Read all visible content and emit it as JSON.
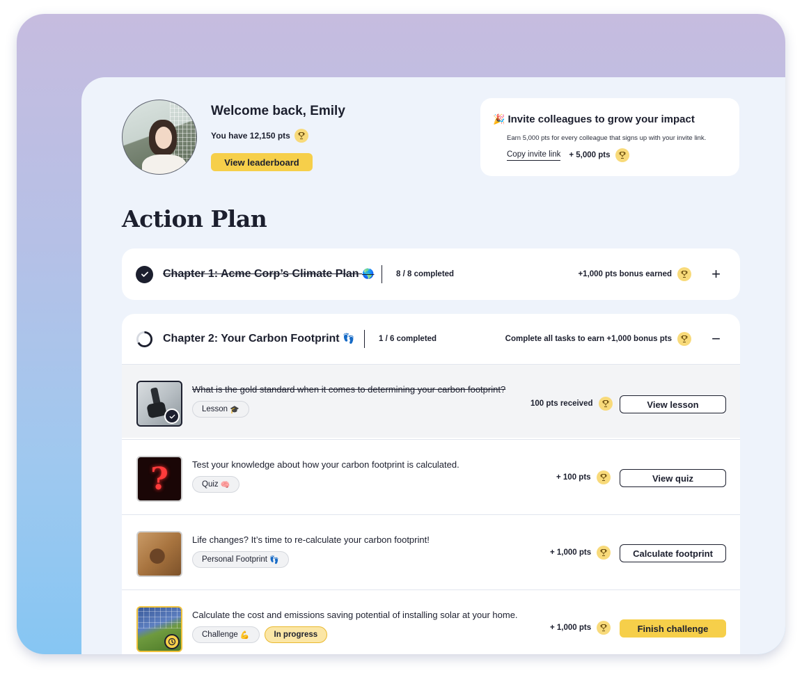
{
  "user": {
    "welcome": "Welcome back, Emily",
    "points_text": "You have 12,150 pts",
    "leaderboard_label": "View leaderboard"
  },
  "invite": {
    "title": "Invite colleagues to grow your impact",
    "title_icon": "party-popper-icon",
    "subtitle": "Earn 5,000 pts for every colleague that signs up with your invite link.",
    "copy_link_label": "Copy invite link",
    "reward": "+ 5,000 pts"
  },
  "page": {
    "title": "Action Plan"
  },
  "chapters": [
    {
      "name": "Chapter 1: Acme Corp’s Climate Plan",
      "emoji": "🌎",
      "status": "completed",
      "count": "8 / 8 completed",
      "bonus": "+1,000 pts bonus earned",
      "toggle": "+"
    },
    {
      "name": "Chapter 2: Your Carbon Footprint",
      "emoji": "👣",
      "status": "in-progress",
      "count": "1 / 6 completed",
      "bonus": "Complete all tasks to earn +1,000 bonus pts",
      "toggle": "−",
      "tasks": [
        {
          "text": "What is the gold standard when it comes to determining your carbon footprint?",
          "tags": [
            {
              "label": "Lesson",
              "emoji": "🎓"
            }
          ],
          "points": "100 pts received",
          "button": "View lesson",
          "state": "completed"
        },
        {
          "text": "Test your knowledge about how your carbon footprint is calculated.",
          "tags": [
            {
              "label": "Quiz",
              "emoji": "🧠"
            }
          ],
          "points": "+ 100 pts",
          "button": "View quiz",
          "state": "todo"
        },
        {
          "text": "Life changes? It’s time to re-calculate your carbon footprint!",
          "tags": [
            {
              "label": "Personal Footprint",
              "emoji": "👣"
            }
          ],
          "points": "+ 1,000 pts",
          "button": "Calculate footprint",
          "state": "todo"
        },
        {
          "text": "Calculate the cost and emissions saving potential of installing solar at your home.",
          "tags": [
            {
              "label": "Challenge",
              "emoji": "💪"
            },
            {
              "label": "In progress",
              "emoji": ""
            }
          ],
          "points": "+ 1,000 pts",
          "button": "Finish challenge",
          "state": "in-progress"
        }
      ]
    }
  ],
  "colors": {
    "accent_yellow": "#f6cf4a",
    "dark": "#1c1f2e",
    "panel": "#eef3fb"
  }
}
